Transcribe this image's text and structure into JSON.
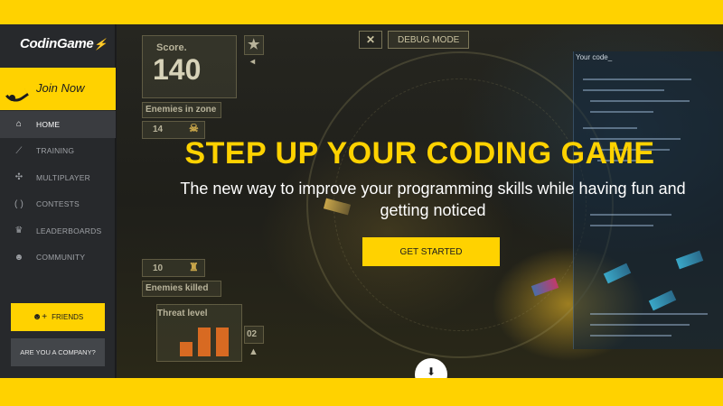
{
  "brand": {
    "logo": "CodinGame"
  },
  "sidebar": {
    "join_label": "Join Now",
    "items": [
      {
        "label": "HOME",
        "icon": "home-icon",
        "active": true
      },
      {
        "label": "TRAINING",
        "icon": "training-icon",
        "active": false
      },
      {
        "label": "MULTIPLAYER",
        "icon": "multiplayer-icon",
        "active": false
      },
      {
        "label": "CONTESTS",
        "icon": "contests-icon",
        "active": false
      },
      {
        "label": "LEADERBOARDS",
        "icon": "trophy-icon",
        "active": false
      },
      {
        "label": "COMMUNITY",
        "icon": "community-icon",
        "active": false
      }
    ],
    "friends_label": "FRIENDS",
    "company_label": "ARE YOU A COMPANY?"
  },
  "hud": {
    "score_label": "Score.",
    "score_value": "140",
    "enemies_zone_label": "Enemies in zone",
    "enemies_zone_value": "14",
    "enemies_killed_value": "10",
    "enemies_killed_label": "Enemies killed",
    "threat_label": "Threat level",
    "threat_value": "02",
    "debug_label": "DEBUG MODE",
    "code_panel_label": "Your code_"
  },
  "hero": {
    "headline": "STEP UP YOUR CODING GAME",
    "subtitle": "The new way to improve your programming skills while having fun and getting noticed",
    "cta_label": "GET STARTED"
  },
  "colors": {
    "accent": "#ffd200",
    "sidebar": "#27292c",
    "active": "#3a3c40"
  }
}
